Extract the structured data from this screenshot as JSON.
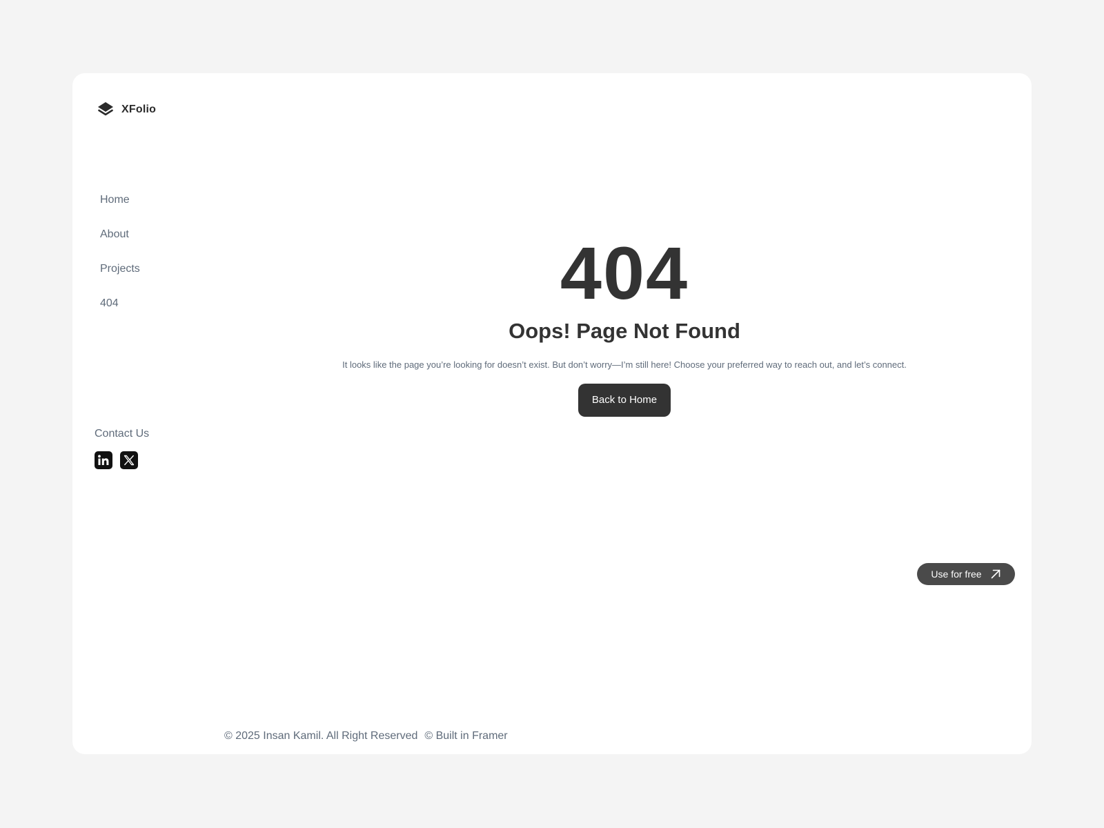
{
  "brand": {
    "name": "XFolio",
    "logo_icon": "layers-icon"
  },
  "nav": {
    "items": [
      {
        "label": "Home"
      },
      {
        "label": "About"
      },
      {
        "label": "Projects"
      },
      {
        "label": "404"
      }
    ]
  },
  "contact": {
    "label": "Contact Us",
    "socials": [
      {
        "icon": "linkedin-icon"
      },
      {
        "icon": "x-twitter-icon"
      }
    ]
  },
  "main": {
    "code": "404",
    "title": "Oops! Page Not Found",
    "message": "It looks like the page you’re looking for doesn’t exist. But don’t worry—I’m still here! Choose your preferred way to reach out, and let’s connect.",
    "button_label": "Back to Home"
  },
  "promo": {
    "label": "Use for free",
    "icon": "arrow-up-right-icon"
  },
  "footer": {
    "copyright": "© 2025 Insan Kamil. All Right Reserved",
    "built_with": "© Built in Framer"
  },
  "colors": {
    "page_background": "#f4f4f4",
    "card_background": "#ffffff",
    "primary_dark": "#333333",
    "muted_text": "#5f6b7a",
    "promo_button": "#4a4a4a"
  }
}
